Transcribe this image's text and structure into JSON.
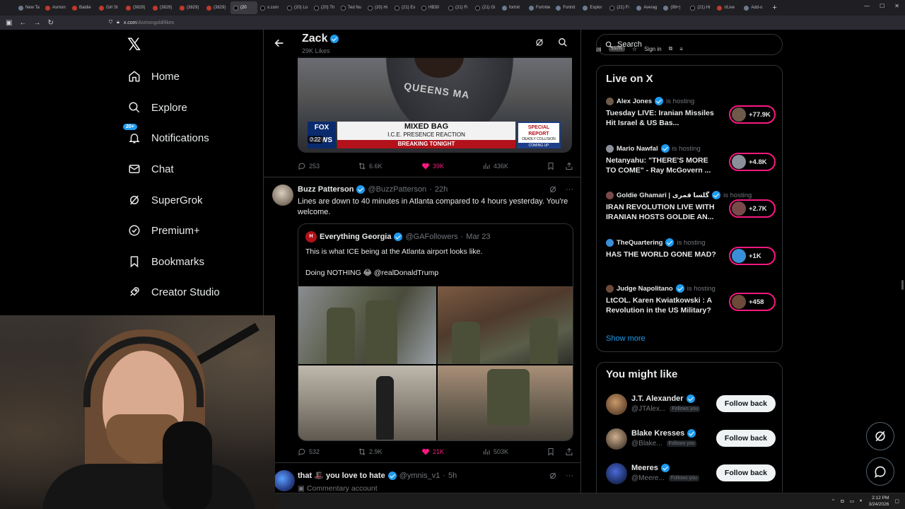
{
  "browser": {
    "tabs": [
      {
        "label": "New Ta",
        "kind": "f",
        "active": false
      },
      {
        "label": "Asmon",
        "kind": "r",
        "active": false
      },
      {
        "label": "Baldie",
        "kind": "r",
        "active": false
      },
      {
        "label": "Girl St",
        "kind": "r",
        "active": false
      },
      {
        "label": "(3829)",
        "kind": "r",
        "active": false
      },
      {
        "label": "(3829)",
        "kind": "r",
        "active": false
      },
      {
        "label": "(3829)",
        "kind": "r",
        "active": false
      },
      {
        "label": "(3829)",
        "kind": "r",
        "active": false
      },
      {
        "label": "(20",
        "kind": "x",
        "active": true
      },
      {
        "label": "x.com",
        "kind": "x",
        "active": false
      },
      {
        "label": "(20) Lo",
        "kind": "x",
        "active": false
      },
      {
        "label": "(20) Th",
        "kind": "x",
        "active": false
      },
      {
        "label": "Ted Nu",
        "kind": "x",
        "active": false
      },
      {
        "label": "(20) Hi",
        "kind": "x",
        "active": false
      },
      {
        "label": "(21) Ex",
        "kind": "x",
        "active": false
      },
      {
        "label": "HB30",
        "kind": "x",
        "active": false
      },
      {
        "label": "(21) Fi",
        "kind": "x",
        "active": false
      },
      {
        "label": "(21) Gi",
        "kind": "x",
        "active": false
      },
      {
        "label": "fortnit",
        "kind": "f",
        "active": false
      },
      {
        "label": "Fortnite",
        "kind": "f",
        "active": false
      },
      {
        "label": "Fortnit",
        "kind": "f",
        "active": false
      },
      {
        "label": "Explor",
        "kind": "f",
        "active": false
      },
      {
        "label": "(21) Fi",
        "kind": "x",
        "active": false
      },
      {
        "label": "Averag",
        "kind": "f",
        "active": false
      },
      {
        "label": "(99+) ",
        "kind": "f",
        "active": false
      },
      {
        "label": "(21) Hi",
        "kind": "x",
        "active": false
      },
      {
        "label": "r/Live",
        "kind": "r",
        "active": false
      },
      {
        "label": "Add-o",
        "kind": "f",
        "active": false
      }
    ],
    "url_main": "x.com",
    "url_path": "/Asmongold/likes",
    "zoom": "150%",
    "sign_in": "Sign in"
  },
  "nav": {
    "items": [
      {
        "label": "Home",
        "icon": "home-icon"
      },
      {
        "label": "Explore",
        "icon": "search-icon"
      },
      {
        "label": "Notifications",
        "icon": "bell-icon"
      },
      {
        "label": "Chat",
        "icon": "mail-icon"
      },
      {
        "label": "SuperGrok",
        "icon": "grok-icon"
      },
      {
        "label": "Premium+",
        "icon": "premium-icon"
      },
      {
        "label": "Bookmarks",
        "icon": "bookmark-icon"
      },
      {
        "label": "Creator Studio",
        "icon": "rocket-icon"
      }
    ],
    "notif_badge": "20+"
  },
  "profile": {
    "name": "Zack",
    "likes": "29K Likes"
  },
  "tweet1": {
    "video": {
      "shirt": "QUEENS MA",
      "channel": "FOX NEWS",
      "banner_main": "MIXED BAG",
      "banner_sub": "I.C.E. PRESENCE REACTION",
      "banner_red": "BREAKING TONIGHT",
      "special_1": "SPECIAL REPORT",
      "special_2": "DEADLY COLLISION",
      "special_3": "COMING UP",
      "time": "0:22"
    },
    "replies": "253",
    "reposts": "6.6K",
    "likes": "39K",
    "views": "436K"
  },
  "tweet2": {
    "name": "Buzz Patterson",
    "handle": "@BuzzPatterson",
    "time": "22h",
    "text": "Lines are down to 40 minutes in Atlanta compared to 4 hours yesterday. You're welcome.",
    "quote": {
      "name": "Everything Georgia",
      "handle": "@GAFollowers",
      "date": "Mar 23",
      "line1": "This is what ICE being at the Atlanta airport looks like.",
      "line2": "Doing NOTHING 😂 @realDonaldTrump"
    },
    "replies": "532",
    "reposts": "2.9K",
    "likes": "21K",
    "views": "503K"
  },
  "tweet3": {
    "name": "that 🎩 you love to hate",
    "handle": "@ymnis_v1",
    "time": "5h",
    "sub": "Commentary account"
  },
  "right": {
    "search_placeholder": "Search",
    "live_title": "Live on X",
    "live": [
      {
        "host": "Alex Jones",
        "status": "is hosting",
        "title": "Tuesday LIVE: Iranian Missiles Hit Israel & US Bas...",
        "count": "+77.9K"
      },
      {
        "host": "Mario Nawfal",
        "status": "is hosting",
        "title": "Netanyahu: \"THERE'S MORE TO COME\" - Ray McGovern ...",
        "count": "+4.8K"
      },
      {
        "host": "Goldie Ghamari | گلسا قمری",
        "status": "is hosting",
        "title": "IRAN REVOLUTION LIVE WITH IRANIAN HOSTS GOLDIE AN...",
        "count": "+2.7K"
      },
      {
        "host": "TheQuartering",
        "status": "is hosting",
        "title": "HAS THE WORLD GONE MAD?",
        "count": "+1K"
      },
      {
        "host": "Judge Napolitano",
        "status": "is hosting",
        "title": "LtCOL. Karen Kwiatkowski : A Revolution in the US Military?",
        "count": "+458"
      }
    ],
    "show_more": "Show more",
    "wtf_title": "You might like",
    "wtf": [
      {
        "name": "J.T. Alexander",
        "handle": "@JTAlex...",
        "badge": "Follows you",
        "btn": "Follow back"
      },
      {
        "name": "Blake Kresses",
        "handle": "@Blake...",
        "badge": "Follows you",
        "btn": "Follow back"
      },
      {
        "name": "Meeres",
        "handle": "@Meere...",
        "badge": "Follows you",
        "btn": "Follow back"
      }
    ]
  },
  "taskbar": {
    "time": "2:12 PM",
    "date": "3/24/2026"
  }
}
